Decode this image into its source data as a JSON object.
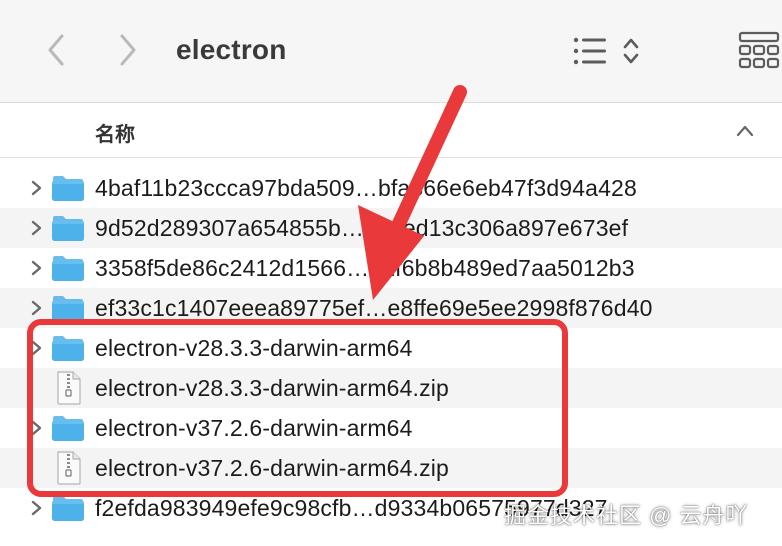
{
  "window": {
    "title": "electron"
  },
  "columns": {
    "name": "名称"
  },
  "files": [
    {
      "name": "4baf11b23ccca97bda509…bfa366e6eb47f3d94a428",
      "kind": "folder",
      "expandable": true,
      "alt": false
    },
    {
      "name": "9d52d289307a654855b…a5eed13c306a897e673ef",
      "kind": "folder",
      "expandable": true,
      "alt": true
    },
    {
      "name": "3358f5de86c2412d1566…a2f6b8b489ed7aa5012b3",
      "kind": "folder",
      "expandable": true,
      "alt": false
    },
    {
      "name": "ef33c1c1407eeea89775ef…e8ffe69e5ee2998f876d40",
      "kind": "folder",
      "expandable": true,
      "alt": true
    },
    {
      "name": "electron-v28.3.3-darwin-arm64",
      "kind": "folder",
      "expandable": true,
      "alt": false
    },
    {
      "name": "electron-v28.3.3-darwin-arm64.zip",
      "kind": "zip",
      "expandable": false,
      "alt": true
    },
    {
      "name": "electron-v37.2.6-darwin-arm64",
      "kind": "folder",
      "expandable": true,
      "alt": false
    },
    {
      "name": "electron-v37.2.6-darwin-arm64.zip",
      "kind": "zip",
      "expandable": false,
      "alt": true
    },
    {
      "name": "f2efda983949efe9c98cfb…d9334b06575977d327",
      "kind": "folder",
      "expandable": true,
      "alt": false
    }
  ],
  "watermark": "掘金技术社区 @ 云舟吖",
  "colors": {
    "folder": "#4db1ea",
    "highlight": "#e9393a",
    "toolbar": "#f6f6f6"
  }
}
